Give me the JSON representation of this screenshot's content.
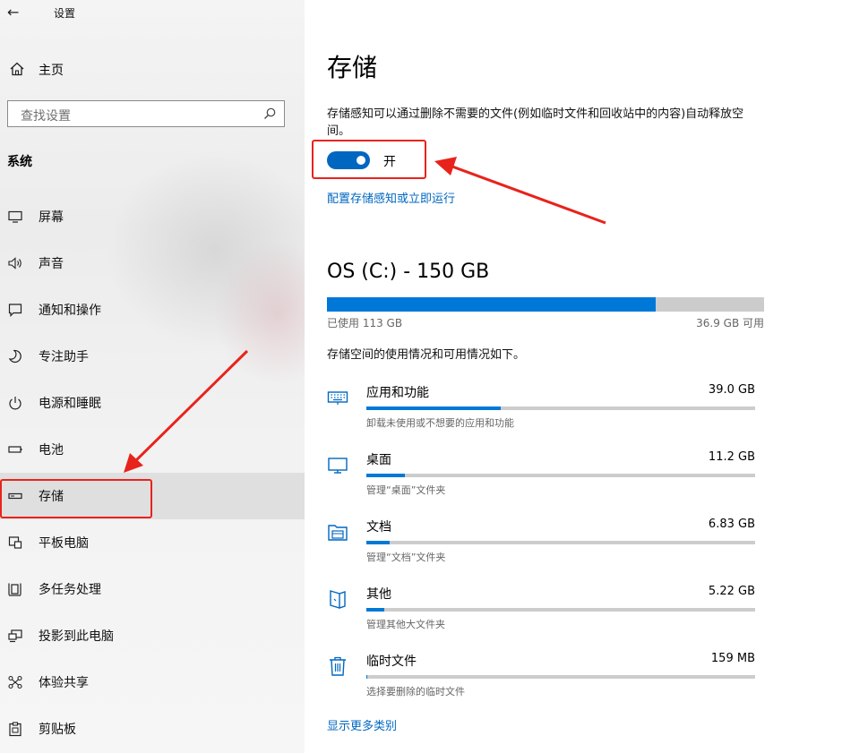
{
  "window": {
    "title": "设置",
    "back_icon": "back-arrow-icon"
  },
  "sidebar": {
    "home": {
      "label": "主页",
      "icon": "home-icon"
    },
    "search": {
      "placeholder": "查找设置",
      "icon": "search-icon"
    },
    "section": "系统",
    "items": [
      {
        "label": "屏幕",
        "icon": "display-icon"
      },
      {
        "label": "声音",
        "icon": "sound-icon"
      },
      {
        "label": "通知和操作",
        "icon": "notification-icon"
      },
      {
        "label": "专注助手",
        "icon": "moon-icon"
      },
      {
        "label": "电源和睡眠",
        "icon": "power-icon"
      },
      {
        "label": "电池",
        "icon": "battery-icon"
      },
      {
        "label": "存储",
        "icon": "storage-icon",
        "selected": true
      },
      {
        "label": "平板电脑",
        "icon": "tablet-icon"
      },
      {
        "label": "多任务处理",
        "icon": "multitask-icon"
      },
      {
        "label": "投影到此电脑",
        "icon": "project-icon"
      },
      {
        "label": "体验共享",
        "icon": "share-icon"
      },
      {
        "label": "剪贴板",
        "icon": "clipboard-icon"
      }
    ]
  },
  "main": {
    "title": "存储",
    "description": "存储感知可以通过删除不需要的文件(例如临时文件和回收站中的内容)自动释放空间。",
    "toggle": {
      "state": true,
      "label": "开"
    },
    "config_link": "配置存储感知或立即运行",
    "drive": {
      "title": "OS (C:) - 150 GB",
      "used": "已使用 113 GB",
      "free": "36.9 GB 可用",
      "used_fraction": 0.753
    },
    "usage_description": "存储空间的使用情况和可用情况如下。",
    "categories": [
      {
        "name": "应用和功能",
        "size": "39.0 GB",
        "subtitle": "卸载未使用或不想要的应用和功能",
        "fraction": 0.345,
        "icon": "keyboard-icon"
      },
      {
        "name": "桌面",
        "size": "11.2 GB",
        "subtitle": "管理“桌面”文件夹",
        "fraction": 0.099,
        "icon": "monitor-icon"
      },
      {
        "name": "文档",
        "size": "6.83 GB",
        "subtitle": "管理“文档”文件夹",
        "fraction": 0.06,
        "icon": "documents-folder-icon"
      },
      {
        "name": "其他",
        "size": "5.22 GB",
        "subtitle": "管理其他大文件夹",
        "fraction": 0.046,
        "icon": "other-files-icon"
      },
      {
        "name": "临时文件",
        "size": "159 MB",
        "subtitle": "选择要删除的临时文件",
        "fraction": 0.0014,
        "icon": "trash-icon"
      }
    ],
    "more_link": "显示更多类别"
  },
  "colors": {
    "accent": "#0067c0",
    "bar_fill": "#0078d7",
    "annotation": "#e8231c"
  }
}
